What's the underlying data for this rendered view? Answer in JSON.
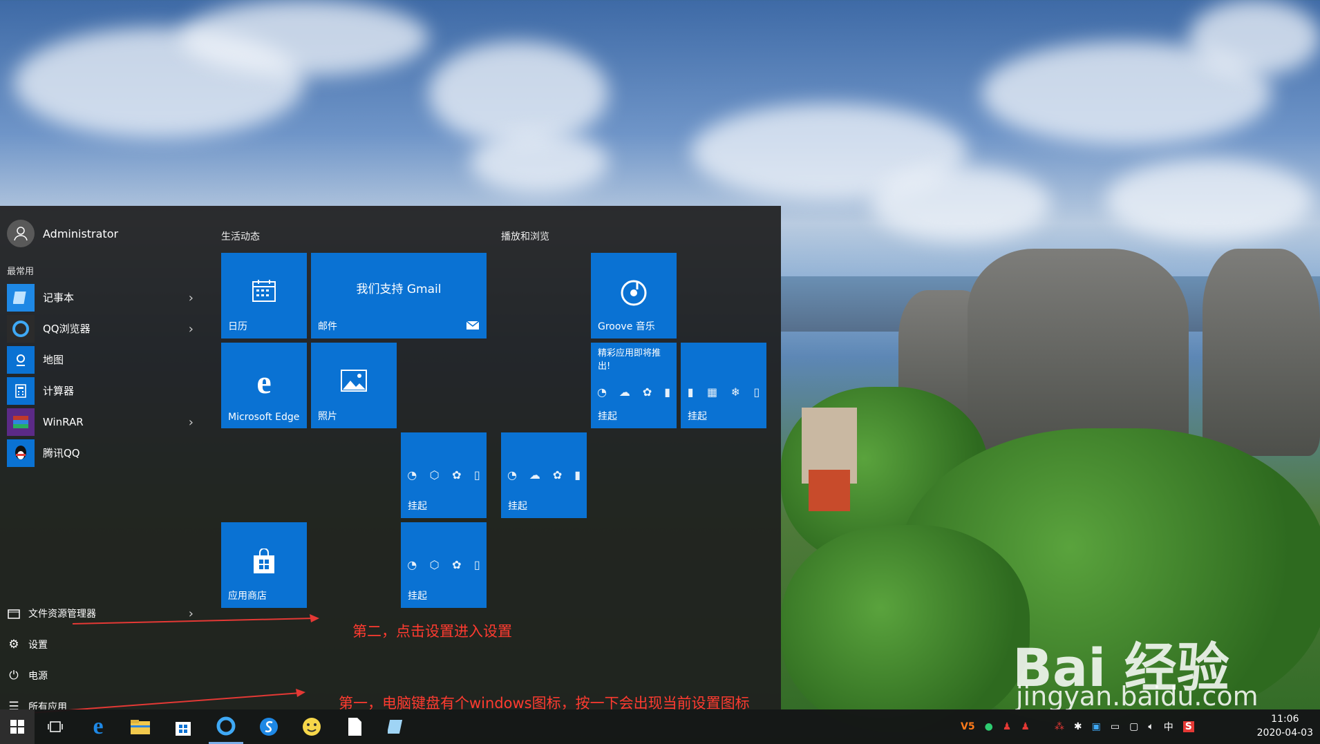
{
  "start_menu": {
    "user_name": "Administrator",
    "most_used_title": "最常用",
    "apps": [
      {
        "label": "记事本",
        "icon": "notepad-icon",
        "has_submenu": true
      },
      {
        "label": "QQ浏览器",
        "icon": "qq-browser-icon",
        "has_submenu": true
      },
      {
        "label": "地图",
        "icon": "maps-icon",
        "has_submenu": false
      },
      {
        "label": "计算器",
        "icon": "calculator-icon",
        "has_submenu": false
      },
      {
        "label": "WinRAR",
        "icon": "winrar-icon",
        "has_submenu": true
      },
      {
        "label": "腾讯QQ",
        "icon": "qq-icon",
        "has_submenu": false
      }
    ],
    "system": {
      "file_explorer": "文件资源管理器",
      "settings": "设置",
      "power": "电源",
      "all_apps": "所有应用"
    },
    "groups": {
      "life": "生活动态",
      "play": "播放和浏览"
    },
    "tiles": {
      "calendar": "日历",
      "mail": "邮件",
      "mail_promo": "我们支持 Gmail",
      "edge": "Microsoft Edge",
      "photos": "照片",
      "store": "应用商店",
      "groove": "Groove 音乐",
      "suggested_title": "精彩应用即将推出!",
      "pending": "挂起"
    }
  },
  "annotations": {
    "step2": "第二，点击设置进入设置",
    "step1": "第一，电脑键盘有个windows图标，按一下会出现当前设置图标"
  },
  "taskbar": {
    "time": "11:06",
    "date": "2020-04-03",
    "ime": "中"
  },
  "watermark": {
    "brand": "Bai 经验",
    "url": "jingyan.baidu.com"
  },
  "colors": {
    "tile": "#0a72d3",
    "annotation": "#ff3b30"
  }
}
